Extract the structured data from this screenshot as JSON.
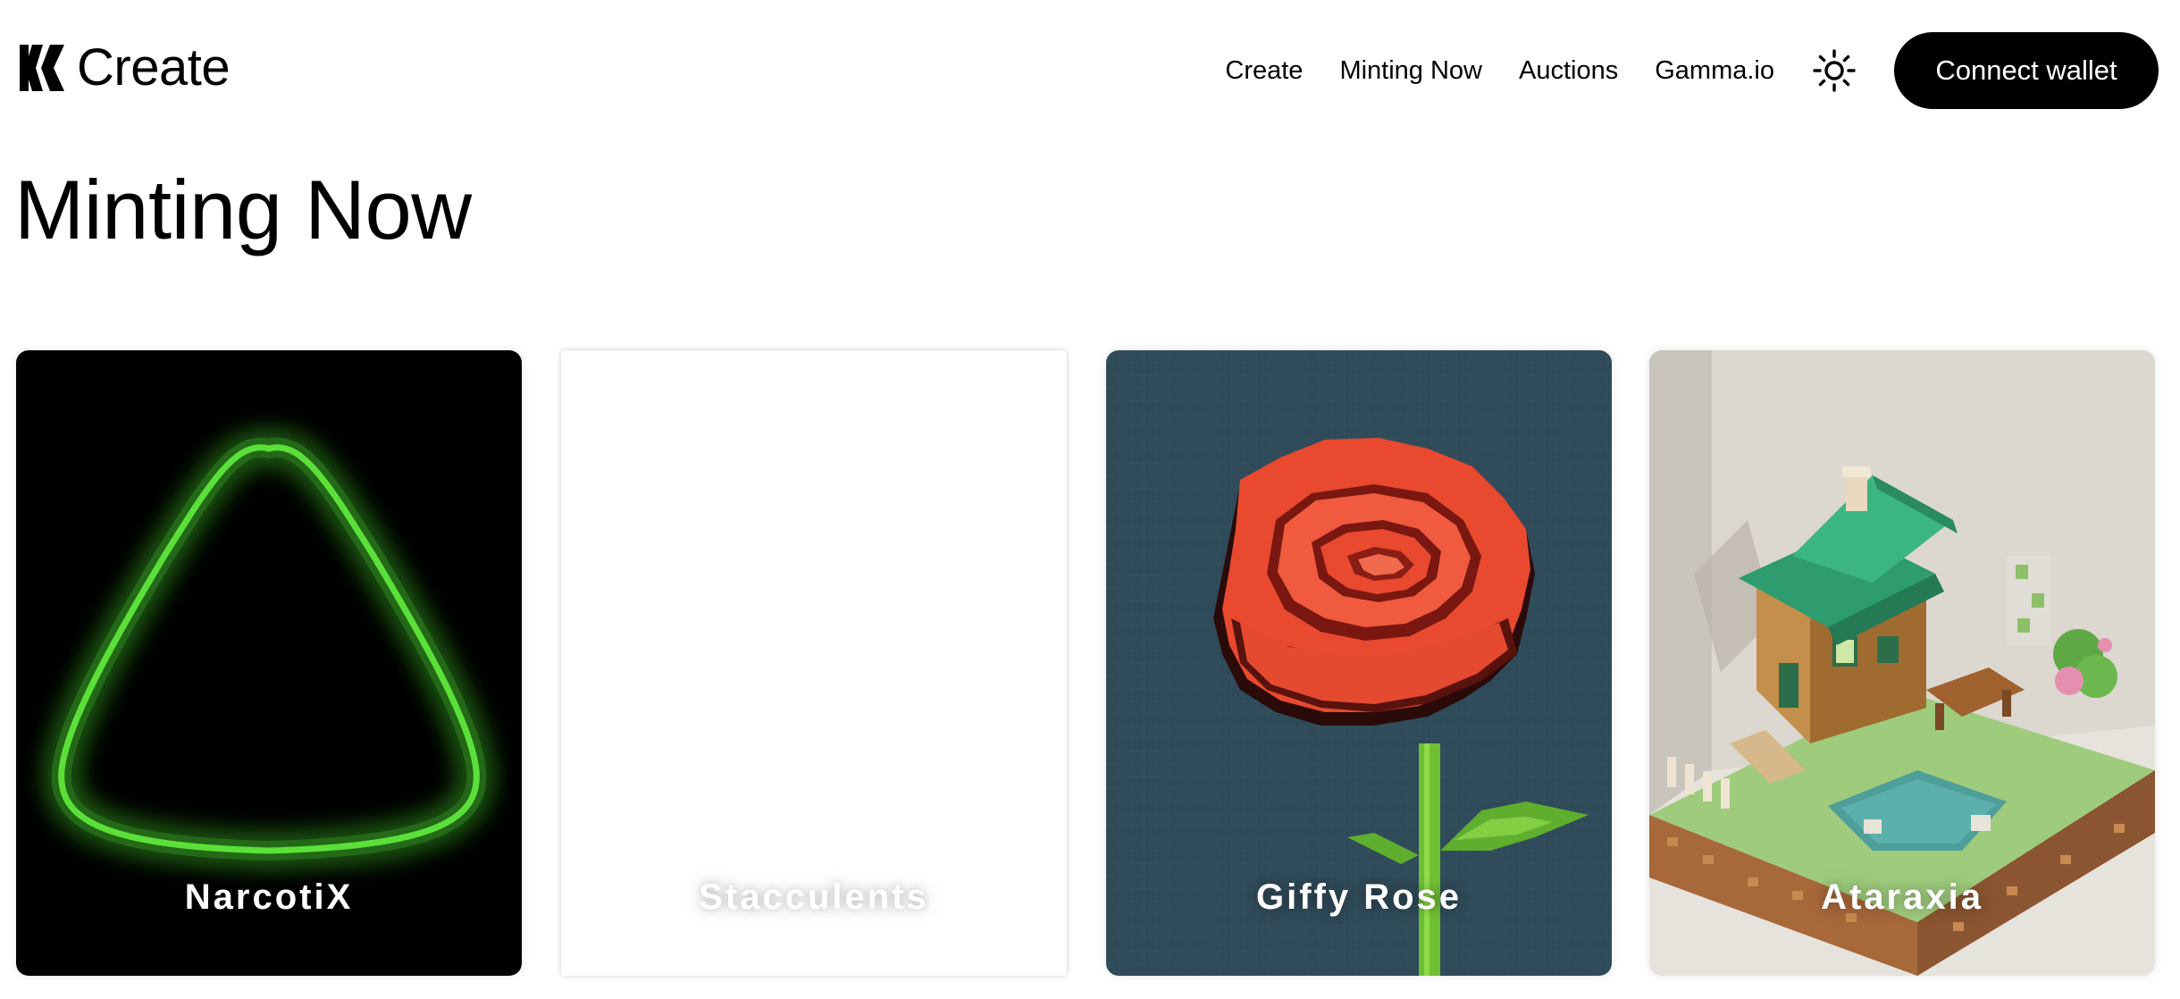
{
  "brand": {
    "name": "Create"
  },
  "nav": {
    "links": [
      "Create",
      "Minting Now",
      "Auctions",
      "Gamma.io"
    ],
    "theme_icon": "sun-icon",
    "connect_label": "Connect wallet"
  },
  "page": {
    "title": "Minting Now"
  },
  "collections": [
    {
      "name": "NarcotiX",
      "background": "#000000",
      "accent": "#5be03a"
    },
    {
      "name": "Stacculents",
      "background": "#ffffff"
    },
    {
      "name": "Giffy Rose",
      "background": "#2f4a58",
      "accent": "#e8492f"
    },
    {
      "name": "Ataraxia",
      "background": "#ddd8d0",
      "accent": "#2f9c74"
    }
  ]
}
